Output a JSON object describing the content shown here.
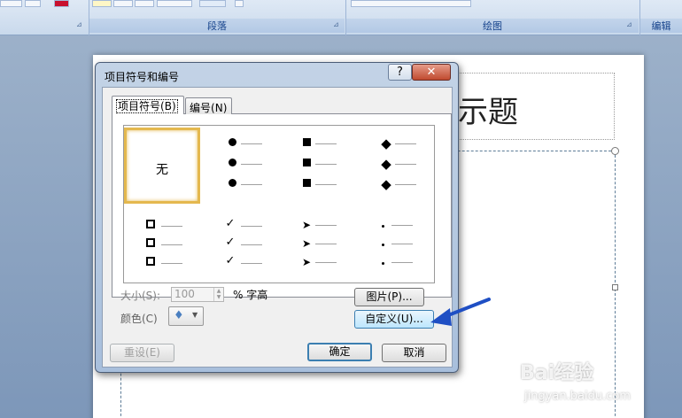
{
  "ribbon": {
    "groups": [
      "段落",
      "绘图",
      "编辑"
    ]
  },
  "slide": {
    "title_fragment": "示题"
  },
  "dialog": {
    "title": "项目符号和编号",
    "help_glyph": "?",
    "close_glyph": "✕",
    "tabs": [
      {
        "label": "项目符号",
        "accel": "B",
        "active": true
      },
      {
        "label": "编号",
        "accel": "N",
        "active": false
      }
    ],
    "none_label": "无",
    "bullet_styles": [
      "none",
      "filled-circle",
      "filled-square",
      "filled-diamond",
      "hollow-square",
      "checkmark",
      "arrowhead",
      "small-dot"
    ],
    "size_label": "大小(S):",
    "size_value": "100",
    "size_unit": "% 字高",
    "color_label": "颜色(C)",
    "picture_button": "图片(P)...",
    "customize_button": "自定义(U)...",
    "reset_button": "重设(E)",
    "ok_button": "确定",
    "cancel_button": "取消"
  },
  "watermark": {
    "logo": "Bai经验",
    "url": "jingyan.baidu.com"
  },
  "colors": {
    "selection_border": "#e4b84e",
    "annotation_arrow": "#1f4fc4",
    "close_button": "#c04a2f"
  }
}
